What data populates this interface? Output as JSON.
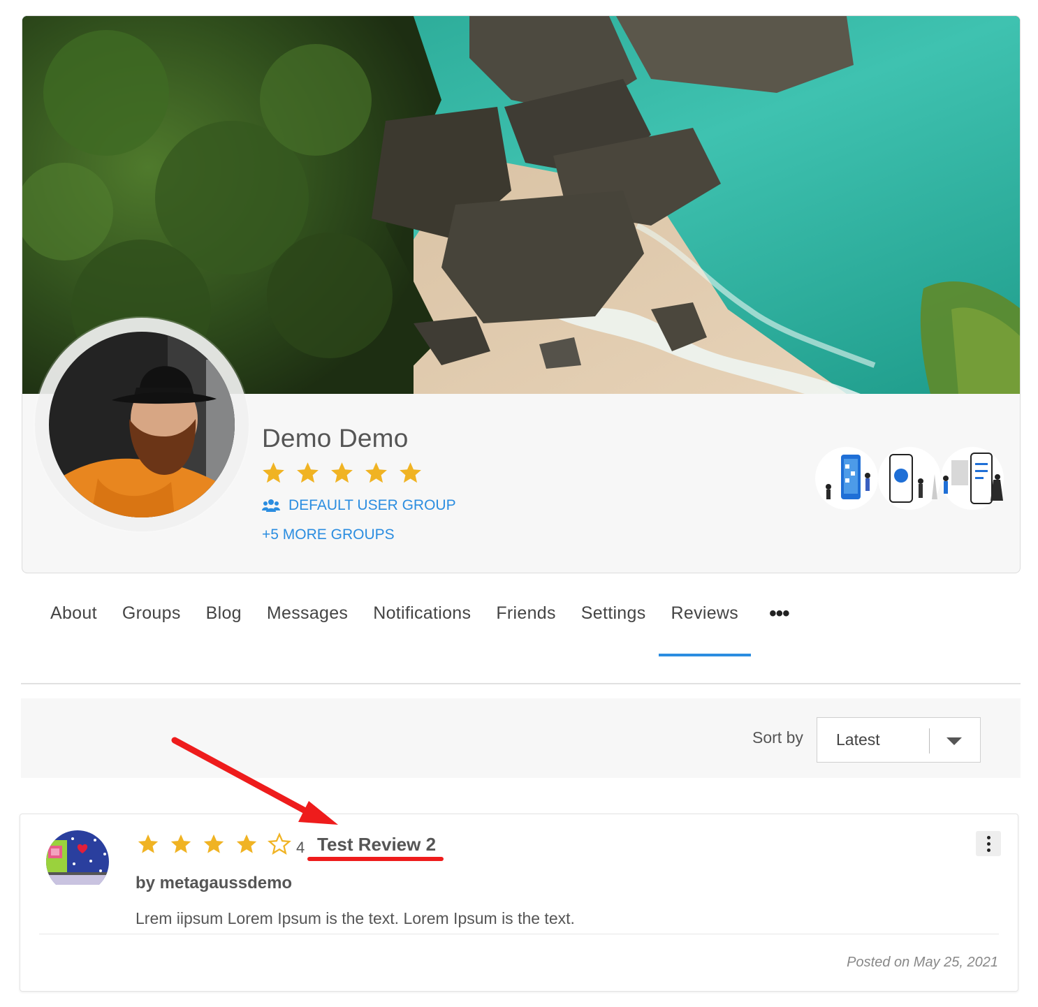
{
  "profile": {
    "display_name": "Demo Demo",
    "rating_stars": 5,
    "primary_group": "DEFAULT USER GROUP",
    "more_groups": "+5 MORE GROUPS"
  },
  "tabs": [
    {
      "label": "About",
      "active": false
    },
    {
      "label": "Groups",
      "active": false
    },
    {
      "label": "Blog",
      "active": false
    },
    {
      "label": "Messages",
      "active": false
    },
    {
      "label": "Notifications",
      "active": false
    },
    {
      "label": "Friends",
      "active": false
    },
    {
      "label": "Settings",
      "active": false
    },
    {
      "label": "Reviews",
      "active": true
    }
  ],
  "tabs_more_icon": "more-horizontal-icon",
  "sort": {
    "label": "Sort by",
    "selected": "Latest"
  },
  "review": {
    "rating": 4,
    "rating_max": 5,
    "rating_text": "4",
    "title": "Test Review 2",
    "author": "by metagaussdemo",
    "body": "Lrem iipsum Lorem Ipsum is the text. Lorem Ipsum is the text.",
    "posted": "Posted on May 25, 2021"
  },
  "colors": {
    "accent": "#2b8de0",
    "star": "#f0b323",
    "annotation": "#ee1c1c"
  }
}
